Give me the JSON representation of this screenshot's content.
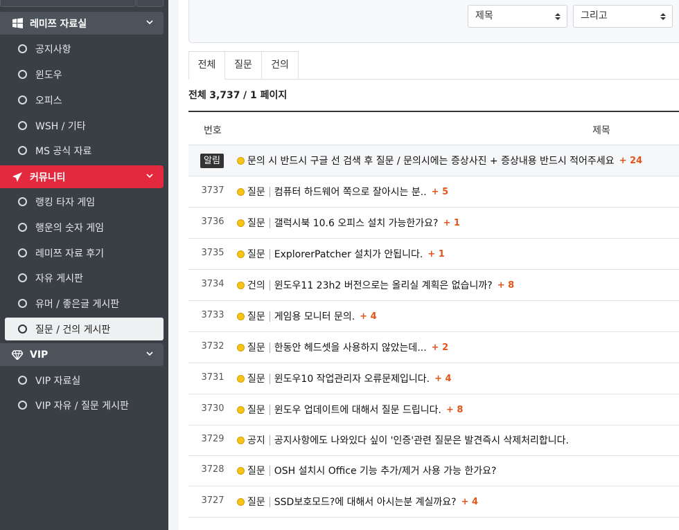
{
  "sidebar": {
    "categories": [
      {
        "label": "레미쯔 자료실",
        "icon": "windows-icon"
      },
      {
        "label": "커뮤니티",
        "icon": "paper-plane-icon"
      },
      {
        "label": "VIP",
        "icon": "diamond-icon"
      }
    ],
    "items": [
      {
        "label": "공지사항"
      },
      {
        "label": "윈도우"
      },
      {
        "label": "오피스"
      },
      {
        "label": "WSH / 기타"
      },
      {
        "label": "MS 공식 자료"
      },
      {
        "label": "랭킹 타자 게임"
      },
      {
        "label": "행운의 숫자 게임"
      },
      {
        "label": "레미쯔 자료 후기"
      },
      {
        "label": "자유 게시판"
      },
      {
        "label": "유머 / 좋은글 게시판"
      },
      {
        "label": "질문 / 건의 게시판"
      },
      {
        "label": "VIP 자료실"
      },
      {
        "label": "VIP 자유 / 질문 게시판"
      }
    ]
  },
  "search": {
    "field_select": "제목",
    "operator_select": "그리고"
  },
  "tabs": [
    {
      "label": "전체"
    },
    {
      "label": "질문"
    },
    {
      "label": "건의"
    }
  ],
  "summary": {
    "prefix": "전체",
    "count": "3,737",
    "pages": "/ 1 페이지"
  },
  "table": {
    "headers": {
      "number": "번호",
      "title": "제목"
    },
    "rows": [
      {
        "number": "알림",
        "category": "",
        "title": "문의 시 반드시 구글 선 검색 후 질문 / 문의시에는 증상사진 + 증상내용 반드시 적어주세요",
        "comments": "+ 24"
      },
      {
        "number": "3737",
        "category": "질문",
        "title": "컴퓨터 하드웨어 쪽으로 잘아시는 분..",
        "comments": "+ 5"
      },
      {
        "number": "3736",
        "category": "질문",
        "title": "갤럭시북 10.6 오피스 설치 가능한가요?",
        "comments": "+ 1"
      },
      {
        "number": "3735",
        "category": "질문",
        "title": "ExplorerPatcher 설치가 안됩니다.",
        "comments": "+ 1"
      },
      {
        "number": "3734",
        "category": "건의",
        "title": "윈도우11 23h2 버전으로는 올리실 계획은 없습니까?",
        "comments": "+ 8"
      },
      {
        "number": "3733",
        "category": "질문",
        "title": "게임용 모니터 문의.",
        "comments": "+ 4"
      },
      {
        "number": "3732",
        "category": "질문",
        "title": "한동안 헤드셋을 사용하지 않았는데...",
        "comments": "+ 2"
      },
      {
        "number": "3731",
        "category": "질문",
        "title": "윈도우10 작업관리자 오류문제입니다.",
        "comments": "+ 4"
      },
      {
        "number": "3730",
        "category": "질문",
        "title": "윈도우 업데이트에 대해서 질문 드립니다.",
        "comments": "+ 8"
      },
      {
        "number": "3729",
        "category": "공지",
        "title": "공지사항에도 나와있다 싶이 '인증'관련 질문은 발견즉시 삭제처리합니다.",
        "comments": ""
      },
      {
        "number": "3728",
        "category": "질문",
        "title": "OSH 설치시 Office 기능 추가/제거 사용 가능 한가요?",
        "comments": ""
      },
      {
        "number": "3727",
        "category": "질문",
        "title": "SSD보호모드?에 대해서 아시는분 계실까요?",
        "comments": "+ 4"
      }
    ]
  }
}
